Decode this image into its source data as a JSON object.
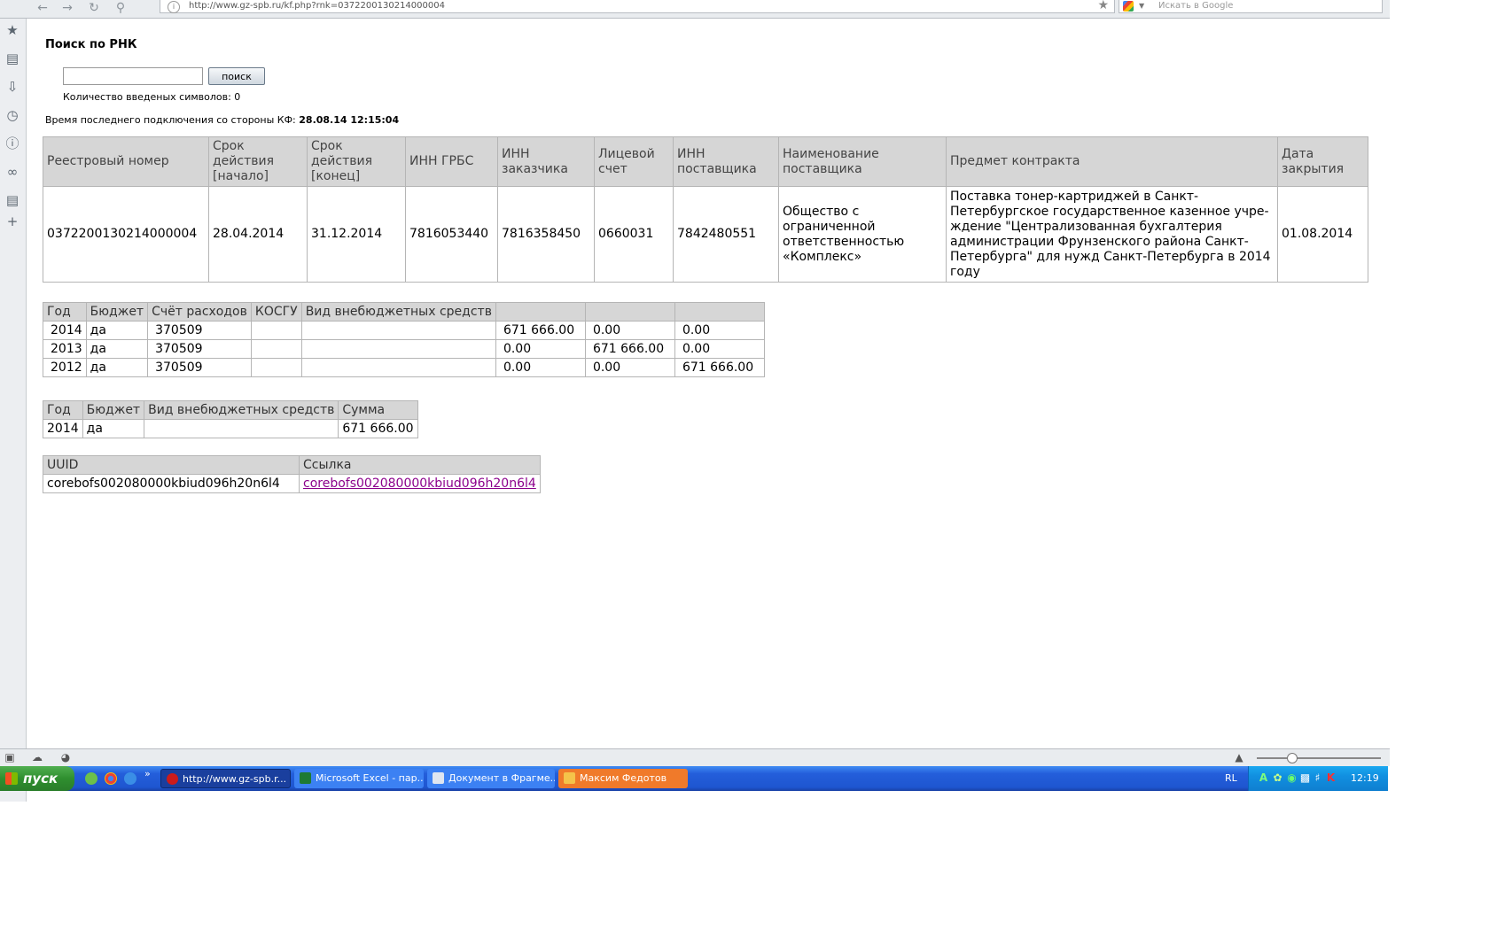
{
  "browser": {
    "url": "http://www.gz-spb.ru/kf.php?rnk=0372200130214000004",
    "search_placeholder": "Искать в Google"
  },
  "page": {
    "title": "Поиск по РНК",
    "search_input_value": "",
    "search_button": "поиск",
    "char_count": "Количество введеных символов: 0",
    "last_connection_label": "Время последнего подключения со стороны КФ:",
    "last_connection_value": "28.08.14 12:15:04"
  },
  "main_table": {
    "headers": [
      "Реестровый номер",
      "Срок действия [начало]",
      "Срок действия [конец]",
      "ИНН ГРБС",
      "ИНН заказчика",
      "Лицевой счет",
      "ИНН поставщика",
      "Наименование поставщика",
      "Предмет контракта",
      "Дата закрытия"
    ],
    "row": [
      "0372200130214000004",
      "28.04.2014",
      "31.12.2014",
      "7816053440",
      "7816358450",
      "0660031",
      "7842480551",
      "Общество с ограниченной ответственностью «Комплекс»",
      "Поставка тонер-картриджей в Санкт-Петербургское государственное казенное учре-ждение \"Централизованная бухгалтерия администрации Фрунзенского района Санкт-Петербурга\" для нужд Санкт-Петербурга в 2014 году",
      "01.08.2014"
    ]
  },
  "years_table": {
    "headers": [
      "Год",
      "Бюджет",
      "Счёт расходов",
      "КОСГУ",
      "Вид внебюджетных средств",
      "",
      "",
      ""
    ],
    "rows": [
      [
        "2014",
        "да",
        "370509",
        "",
        "",
        "671 666.00",
        "0.00",
        "0.00"
      ],
      [
        "2013",
        "да",
        "370509",
        "",
        "",
        "0.00",
        "671 666.00",
        "0.00"
      ],
      [
        "2012",
        "да",
        "370509",
        "",
        "",
        "0.00",
        "0.00",
        "671 666.00"
      ]
    ]
  },
  "budget_table": {
    "headers": [
      "Год",
      "Бюджет",
      "Вид внебюджетных средств",
      "Сумма"
    ],
    "row": [
      "2014",
      "да",
      "",
      "671 666.00"
    ]
  },
  "uuid_table": {
    "headers": [
      "UUID",
      "Ссылка"
    ],
    "uuid": "corebofs002080000kbiud096h20n6l4",
    "link": "corebofs002080000kbiud096h20n6l4"
  },
  "taskbar": {
    "start_label": "пуск",
    "tasks": [
      "http://www.gz-spb.r...",
      "Microsoft Excel - пар...",
      "Документ в Фрагме...",
      "Максим Федотов"
    ],
    "language": "RL",
    "clock": "12:19"
  },
  "colors": {
    "header_bg": "#d6d6d6",
    "link_visited": "#8b008b",
    "taskbar_blue": "#245edb",
    "start_green": "#2f8f2f"
  }
}
